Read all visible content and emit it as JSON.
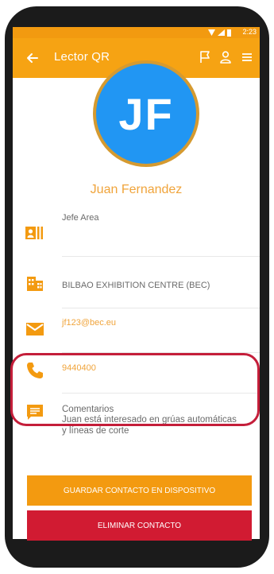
{
  "status": {
    "time": "2:23"
  },
  "appbar": {
    "title": "Lector QR"
  },
  "contact": {
    "initials": "JF",
    "name": "Juan Fernandez",
    "position": "Jefe Area",
    "company": "BILBAO EXHIBITION CENTRE (BEC)",
    "email": "jf123@bec.eu",
    "phone": "9440400",
    "comments_label": "Comentarios",
    "comments_line1": "Juan está interesado en grúas automáticas",
    "comments_line2": "y líneas de corte"
  },
  "buttons": {
    "save": "GUARDAR CONTACTO EN DISPOSITIVO",
    "delete": "ELIMINAR CONTACTO"
  },
  "colors": {
    "accent": "#f6a313",
    "name": "#f0a43b",
    "avatar": "#2196f3",
    "delete": "#d11b32",
    "highlight": "#c41e3a"
  },
  "icons": [
    "back-arrow-icon",
    "flag-icon",
    "person-icon",
    "menu-icon",
    "id-card-icon",
    "building-icon",
    "mail-icon",
    "phone-icon",
    "comment-icon"
  ]
}
